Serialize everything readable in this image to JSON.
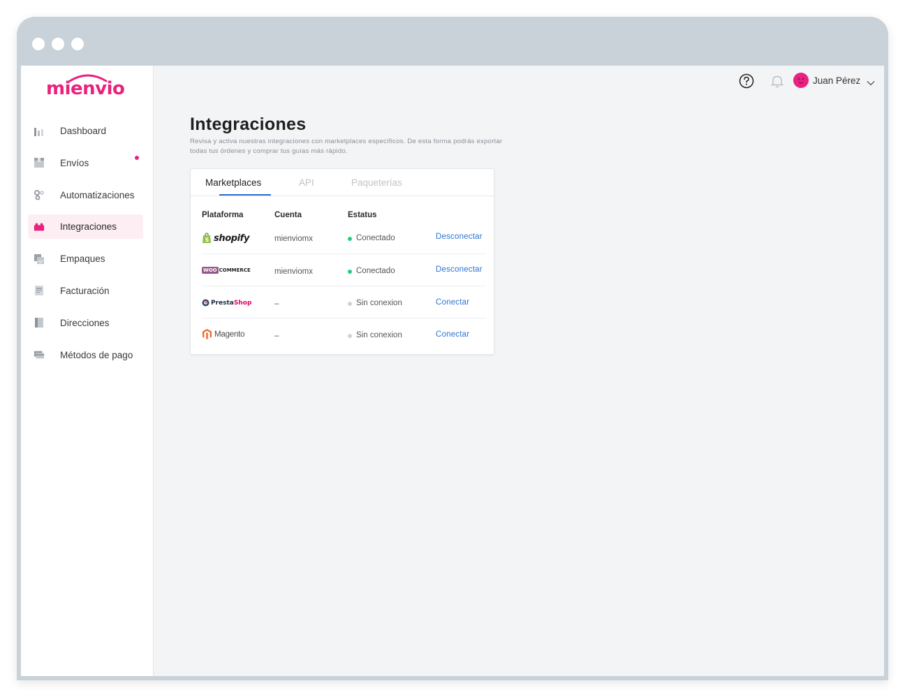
{
  "brand": {
    "name": "mienvio",
    "color": "#e8227e"
  },
  "sidebar": {
    "items": [
      {
        "label": "Dashboard",
        "icon": "bar-chart-icon",
        "active": false,
        "has_notification": false
      },
      {
        "label": "Envíos",
        "icon": "box-icon",
        "active": false,
        "has_notification": true
      },
      {
        "label": "Automatizaciones",
        "icon": "gears-icon",
        "active": false,
        "has_notification": false
      },
      {
        "label": "Integraciones",
        "icon": "puzzle-icon",
        "active": true,
        "has_notification": false
      },
      {
        "label": "Empaques",
        "icon": "package-icon",
        "active": false,
        "has_notification": false
      },
      {
        "label": "Facturación",
        "icon": "invoice-icon",
        "active": false,
        "has_notification": false
      },
      {
        "label": "Direcciones",
        "icon": "address-book-icon",
        "active": false,
        "has_notification": false
      },
      {
        "label": "Métodos de pago",
        "icon": "credit-card-icon",
        "active": false,
        "has_notification": false
      }
    ]
  },
  "header": {
    "user_name": "Juan Pérez"
  },
  "main": {
    "title": "Integraciones",
    "description": "Revisa y activa nuestras integraciones con marketplaces específicos. De esta forma podrás exportar todas tus órdenes y comprar tus guías más rápido.",
    "tabs": [
      {
        "label": "Marketplaces",
        "active": true
      },
      {
        "label": "API",
        "active": false
      },
      {
        "label": "Paqueterías",
        "active": false
      }
    ],
    "table": {
      "headers": [
        "Plataforma",
        "Cuenta",
        "Estatus"
      ],
      "rows": [
        {
          "platform": "shopify",
          "account": "mienviomx",
          "status": "Conectado",
          "status_color": "#1fcf7a",
          "action": "Desconectar"
        },
        {
          "platform": "WooCommerce",
          "logo_woo": "WOO",
          "logo_commerce": "COMMERCE",
          "account": "mienviomx",
          "status": "Conectado",
          "status_color": "#1fcf7a",
          "action": "Desconectar"
        },
        {
          "platform": "PrestaShop",
          "logo_presta": "Presta",
          "logo_shop": "Shop",
          "account": "–",
          "status": "Sin conexion",
          "status_color": "#cfd2d6",
          "action": "Conectar"
        },
        {
          "platform": "Magento",
          "account": "–",
          "status": "Sin conexion",
          "status_color": "#cfd2d6",
          "action": "Conectar"
        }
      ]
    }
  }
}
